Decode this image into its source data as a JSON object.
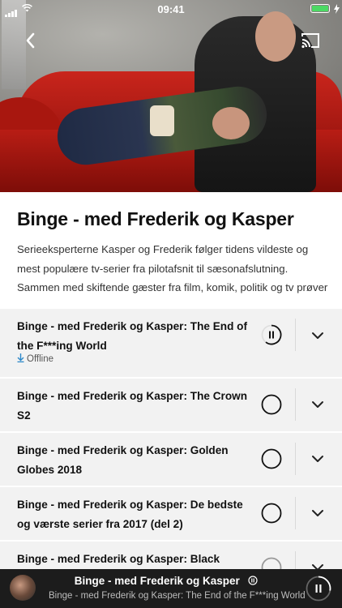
{
  "status_bar": {
    "time": "09:41"
  },
  "podcast": {
    "title": "Binge - med Frederik og Kasper",
    "description": "Serieeksperterne Kasper og Frederik følger tidens vildeste og mest populære tv-serier fra pilotafsnit til sæsonafslutning. Sammen med skiftende gæster fra film, komik, politik og tv prøver de at finde ho…"
  },
  "episodes": [
    {
      "title": "Binge - med Frederik og Kasper: The End of the F***ing World",
      "status": "Offline",
      "state": "playing"
    },
    {
      "title": "Binge - med Frederik og Kasper: The Crown S2",
      "status": "",
      "state": "unplayed"
    },
    {
      "title": "Binge - med Frederik og Kasper: Golden Globes 2018",
      "status": "",
      "state": "unplayed"
    },
    {
      "title": "Binge - med Frederik og Kasper: De bedste og værste serier fra 2017 (del 2)",
      "status": "",
      "state": "unplayed"
    },
    {
      "title": "Binge - med Frederik og Kasper: Black",
      "status": "",
      "state": "unplayed"
    }
  ],
  "player": {
    "title": "Binge - med Frederik og Kasper",
    "subtitle": "Binge - med Frederik og Kasper: The End of the F***ing World"
  },
  "colors": {
    "accent": "#2b87c8",
    "battery": "#4cd964",
    "list_bg": "#f2f2f2",
    "player_bg": "#1c1c1c"
  },
  "icons": {
    "back": "chevron-left-icon",
    "cast": "cast-icon",
    "expand": "chevron-down-icon",
    "play": "play-circle-icon",
    "pause": "pause-icon",
    "download": "download-arrow-icon"
  }
}
